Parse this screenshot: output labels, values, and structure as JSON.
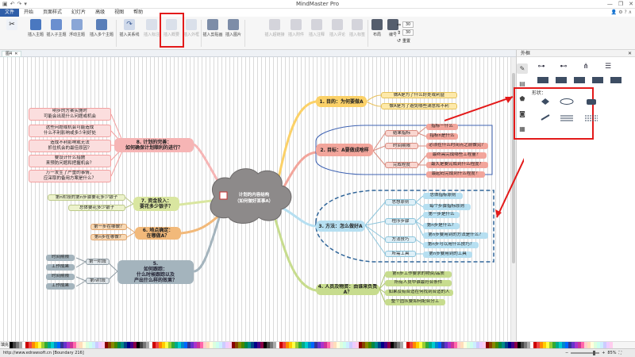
{
  "app": {
    "title": "MindMaster Pro",
    "quick_access": [
      "▣",
      "↶",
      "↷",
      "▾"
    ],
    "window_controls": [
      "—",
      "❐",
      "✕"
    ]
  },
  "menu": {
    "items": [
      "文件",
      "开始",
      "页面样式",
      "幻灯片",
      "高级",
      "视图",
      "帮助"
    ],
    "active": "文件"
  },
  "ribbon": {
    "buttons": [
      "插入主题",
      "插入子主题",
      "浮动主题",
      "插入多个主题",
      "插入关系线",
      "插入标注",
      "插入概要",
      "插入外框",
      "插入剪贴画",
      "插入图片",
      "插入超链接",
      "插入附件",
      "插入注释",
      "插入评论",
      "插入标签",
      "布局",
      "编号"
    ],
    "spacing_h": "30",
    "spacing_v": "30",
    "reset_label": "重置"
  },
  "tab": {
    "label": "图4",
    "close": "✕"
  },
  "panel": {
    "title": "外框",
    "style_label": "形状："
  },
  "status": {
    "url": "http://www.edrawsoft.cn   [Boundary 216]",
    "zoom": "85%",
    "palette_label": "填充"
  },
  "mindmap": {
    "central": "计划的内容结构\n（如何做好某事A）",
    "b1": {
      "title": "1. 目的：为何要做A",
      "leaves": [
        "做A是为了什么好处或利益",
        "做A是为了避免哪些满意和不利"
      ]
    },
    "b2": {
      "title": "2. 目标：A要做成啥样",
      "subs": [
        "结果指标",
        "时间期限",
        "完成程度"
      ],
      "leaves": [
        "指标一什么",
        "指标n是什么",
        "必须在什么时间点之前做完？",
        "最终需完成哪些工程量？",
        "最久是要完成到什么程度？",
        "最起码完成到什么程度？"
      ]
    },
    "b3": {
      "title": "3. 方法：怎么做好A",
      "subs": [
        "思想原则",
        "程序步骤",
        "方法技巧",
        "所需工具"
      ],
      "leaves": [
        "总体指标原则",
        "每个步骤指标原则",
        "第一步是什么",
        "第n步是什么？",
        "第n步要用到的方法是什么？",
        "第n步可以用什么技巧？",
        "第n步要用到的工具"
      ]
    },
    "b4": {
      "title": "4. 人员及物资：由谁来负责A？",
      "leaves": [
        "第n步工作要求的物资/品质",
        "所有人员中谁最符合条件",
        "如果及有合适在何找到合适的人",
        "整个团队要如何配合分工"
      ]
    },
    "b5": {
      "title": "5.\n如何跟踪：\n什么时候跟踪以及\n产出什么样的效果？",
      "subs": [
        "第一阶段",
        "第n阶段"
      ],
      "leaves": [
        "时间期限",
        "工作成果",
        "时间期限",
        "工作成果"
      ]
    },
    "b6": {
      "title": "6. 地点确定：\n在哪做A？",
      "leaves": [
        "第一步在哪做？",
        "第n步在哪做？"
      ]
    },
    "b7": {
      "title": "7. 资金投入：\n要花多少银子？",
      "leaves": [
        "第n阶段的第n步骤要花多少银子",
        "总体要花多少银子"
      ]
    },
    "b8": {
      "title": "8. 计划的完善：\n如何确保计划顺利的进行？",
      "leaves": [
        "明步的方案实施时\n可能会出现什么问题或机会",
        "这些问题或机会可能造成\n什么不利影响或多少利好处",
        "造成不利影响或无法\n抓住机会的最佳原因？",
        "要设计什么措施\n来预防问题和把握机会？",
        "万一发生了严重的事情，\n应采取的备用方案是什么？"
      ]
    }
  },
  "colors": {
    "menu_active": "#2f5ea8",
    "annotation_red": "#e31a1a",
    "b1": "#fbd168",
    "b2": "#f2a59b",
    "b3": "#b6dff1",
    "b4": "#c7dc8e",
    "b5": "#a4b4bd",
    "b6": "#f2b97a",
    "b7": "#d9e6a0",
    "b8": "#f6b5b5",
    "cloud": "#8d8a8a"
  }
}
